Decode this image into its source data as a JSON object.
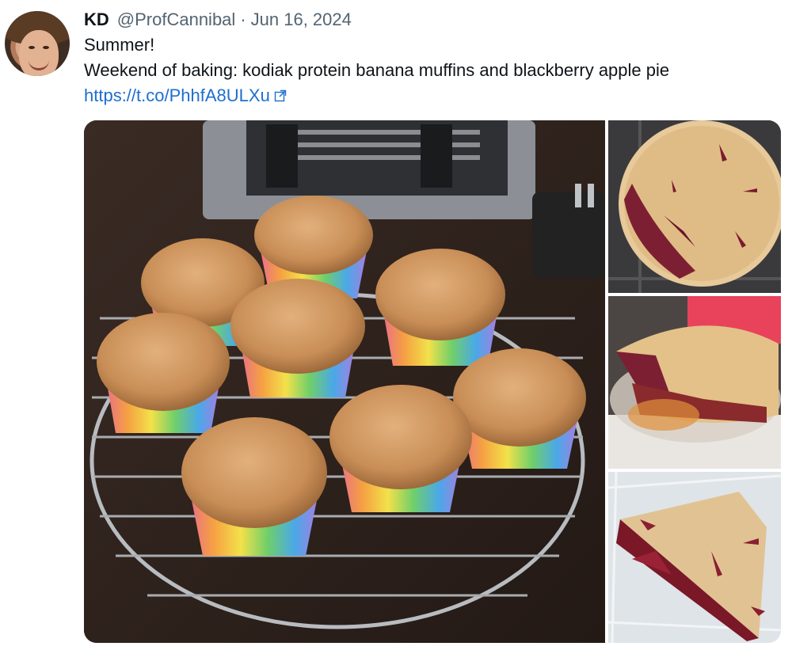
{
  "tweet": {
    "display_name": "KD",
    "handle": "@ProfCannibal",
    "separator": "·",
    "date": "Jun 16, 2024",
    "text_line_1": "Summer!",
    "text_line_2": "Weekend of baking: kodiak protein banana muffins and blackberry apple pie",
    "link_text": "https://t.co/PhhfA8ULXu"
  },
  "media": {
    "photos": [
      {
        "subject": "muffins-on-cooling-rack"
      },
      {
        "subject": "blackberry-apple-pie-whole"
      },
      {
        "subject": "blackberry-apple-pie-sliced"
      },
      {
        "subject": "pie-slice-in-container"
      }
    ]
  },
  "colors": {
    "link": "#1d6fcf",
    "meta_text": "#536471",
    "text": "#0f1419"
  },
  "icons": {
    "external_link": "external-link-icon"
  }
}
